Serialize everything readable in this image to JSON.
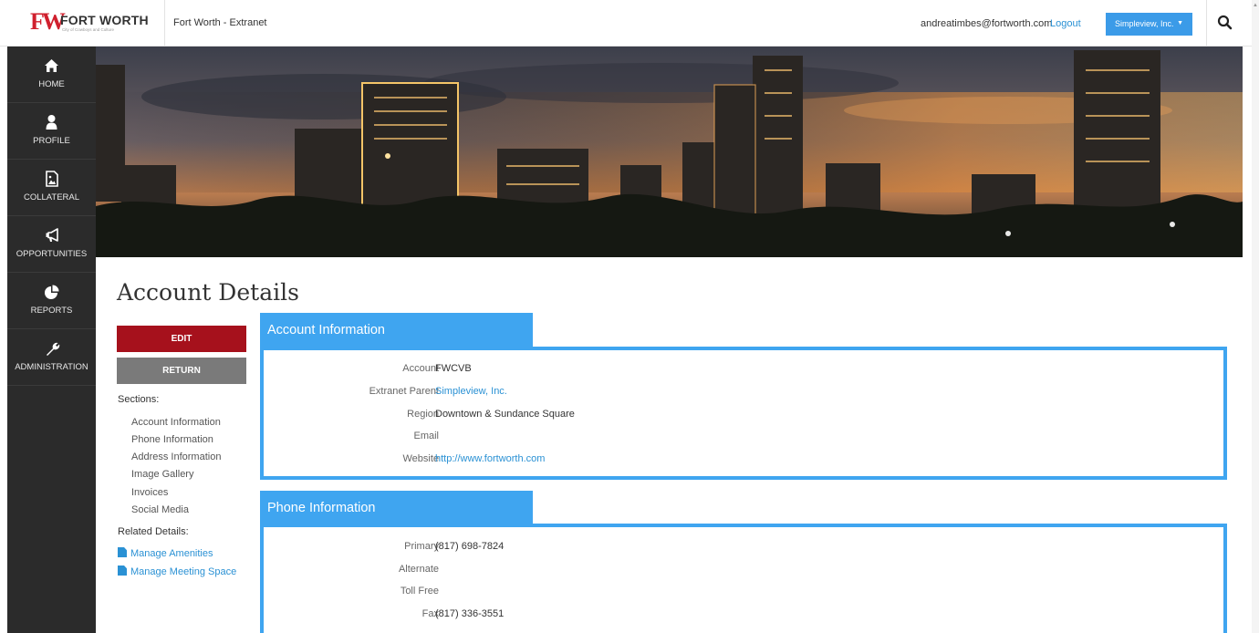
{
  "brand": {
    "logo_mark": "FW",
    "logo_name": "FORT WORTH",
    "logo_tagline": "City of Cowboys and Culture"
  },
  "header": {
    "site_title": "Fort Worth - Extranet",
    "user_email": "andreatimbes@fortworth.com",
    "logout_label": "Logout",
    "org_selected": "Simpleview, Inc.",
    "search_icon": "search-icon"
  },
  "sidebar": {
    "items": [
      {
        "label": "HOME",
        "icon": "home-icon"
      },
      {
        "label": "PROFILE",
        "icon": "user-icon"
      },
      {
        "label": "COLLATERAL",
        "icon": "image-file-icon"
      },
      {
        "label": "OPPORTUNITIES",
        "icon": "megaphone-icon"
      },
      {
        "label": "REPORTS",
        "icon": "pie-chart-icon"
      },
      {
        "label": "ADMINISTRATION",
        "icon": "wrench-icon"
      }
    ]
  },
  "page": {
    "title": "Account Details",
    "edit_label": "EDIT",
    "return_label": "RETURN",
    "sections_heading": "Sections:",
    "sections": [
      "Account Information",
      "Phone Information",
      "Address Information",
      "Image Gallery",
      "Invoices",
      "Social Media"
    ],
    "related_heading": "Related Details:",
    "related": [
      "Manage Amenities",
      "Manage Meeting Space"
    ]
  },
  "account_info": {
    "heading": "Account Information",
    "rows": [
      {
        "label": "Account",
        "value": "FWCVB"
      },
      {
        "label": "Extranet Parent",
        "value": "Simpleview, Inc."
      },
      {
        "label": "Region",
        "value": "Downtown & Sundance Square"
      },
      {
        "label": "Email",
        "value": ""
      },
      {
        "label": "Website",
        "value": "http://www.fortworth.com"
      }
    ]
  },
  "phone_info": {
    "heading": "Phone Information",
    "rows": [
      {
        "label": "Primary",
        "value": "(817) 698-7824"
      },
      {
        "label": "Alternate",
        "value": ""
      },
      {
        "label": "Toll Free",
        "value": ""
      },
      {
        "label": "Fax",
        "value": "(817) 336-3551"
      }
    ]
  },
  "colors": {
    "brand_red": "#d0202e",
    "accent_blue": "#3fa5f0",
    "edit_red": "#a6111c",
    "sidebar": "#2b2b2b"
  }
}
